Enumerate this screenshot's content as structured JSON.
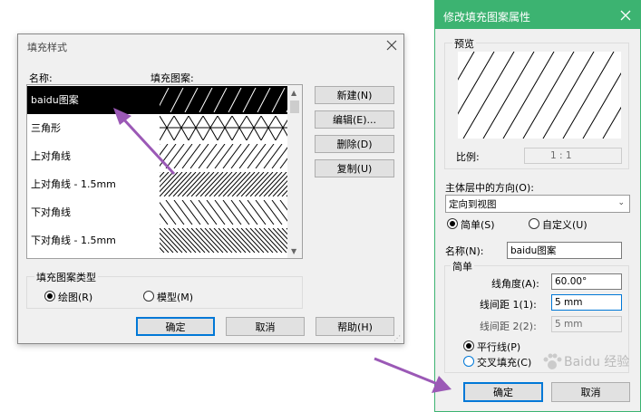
{
  "left_dialog": {
    "title": "填充样式",
    "col_name": "名称:",
    "col_pattern": "填充图案:",
    "rows": [
      {
        "name": "baidu图案",
        "pattern": "slash-sparse",
        "selected": true
      },
      {
        "name": "三角形",
        "pattern": "triangle"
      },
      {
        "name": "上对角线",
        "pattern": "slash"
      },
      {
        "name": "上对角线 - 1.5mm",
        "pattern": "slash-dense"
      },
      {
        "name": "下对角线",
        "pattern": "backslash"
      },
      {
        "name": "下对角线 - 1.5mm",
        "pattern": "backslash-dense"
      }
    ],
    "buttons": {
      "new": "新建(N)",
      "edit": "编辑(E)...",
      "delete": "删除(D)",
      "copy": "复制(U)"
    },
    "type_group": {
      "label": "填充图案类型",
      "drafting": "绘图(R)",
      "model": "模型(M)",
      "selected": "drafting"
    },
    "ok": "确定",
    "cancel": "取消",
    "help": "帮助(H)"
  },
  "right_dialog": {
    "title": "修改填充图案属性",
    "preview_label": "预览",
    "scale_label": "比例:",
    "scale_value": "1 : 1",
    "orientation_label": "主体层中的方向(O):",
    "orientation_value": "定向到视图",
    "simple": "简单(S)",
    "custom": "自定义(U)",
    "selected_mode": "simple",
    "name_label": "名称(N):",
    "name_value": "baidu图案",
    "simple_group": "简单",
    "angle_label": "线角度(A):",
    "angle_value": "60.00°",
    "spacing1_label": "线间距 1(1):",
    "spacing1_value": "5 mm",
    "spacing2_label": "线间距 2(2):",
    "spacing2_value": "5 mm",
    "parallel": "平行线(P)",
    "crosshatch": "交叉填充(C)",
    "selected_hatch": "parallel",
    "ok": "确定",
    "cancel": "取消"
  },
  "watermark": "Baidu 经验",
  "colors": {
    "arrow": "#9b59b6",
    "accent": "#3cb371",
    "selection": "#000000"
  }
}
